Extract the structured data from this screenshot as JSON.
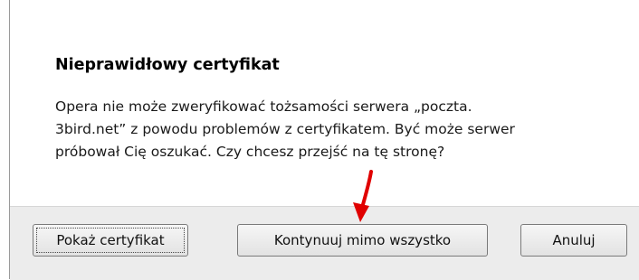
{
  "dialog": {
    "title": "Nieprawidłowy certyfikat",
    "message_lines": [
      "Opera nie może zweryfikować tożsamości serwera „poczta.",
      "3bird.net” z powodu problemów z certyfikatem. Być może serwer",
      "próbował Cię oszukać. Czy chcesz przejść na tę stronę?"
    ]
  },
  "buttons": {
    "show_certificate": "Pokaż certyfikat",
    "continue_anyway": "Kontynuuj mimo wszystko",
    "cancel": "Anuluj"
  },
  "annotation": {
    "arrow_icon": "red-arrow-down-icon",
    "arrow_color": "#e00000"
  },
  "colors": {
    "button_bar": "#ececec",
    "background": "#ffffff"
  }
}
